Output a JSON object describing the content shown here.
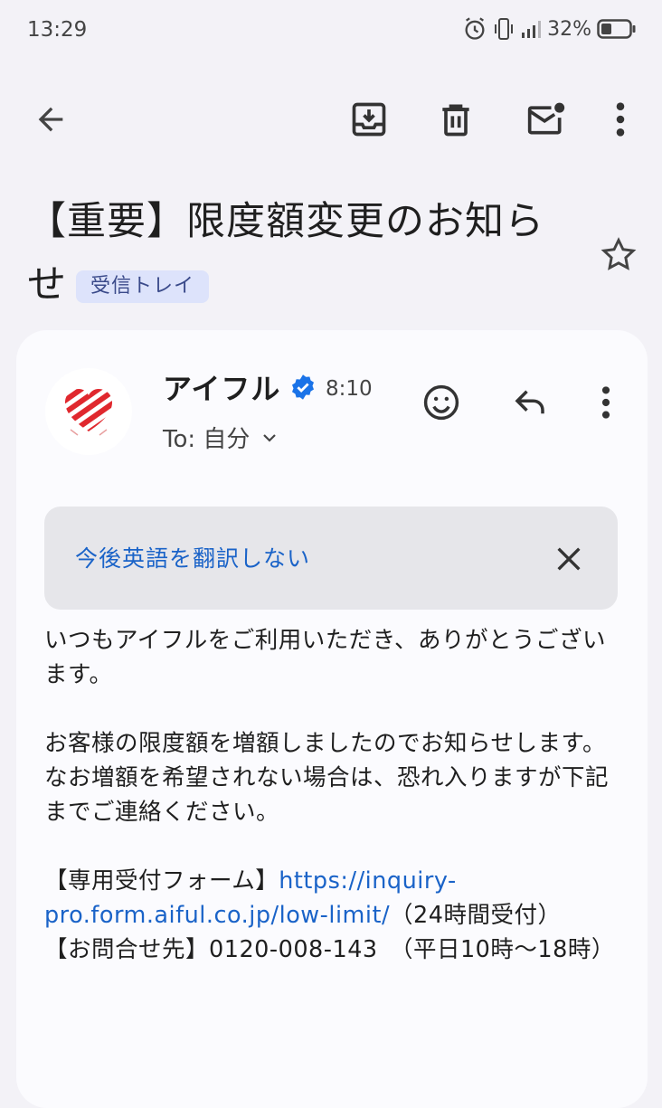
{
  "status_bar": {
    "time": "13:29",
    "battery": "32%",
    "icons": [
      "alarm-icon",
      "vibrate-icon",
      "signal-icon",
      "battery-icon"
    ]
  },
  "app_bar": {
    "icons": [
      "back-arrow-icon",
      "archive-icon",
      "delete-icon",
      "mark-unread-icon",
      "more-vert-icon"
    ]
  },
  "subject": {
    "text": "【重要】限度額変更のお知らせ",
    "label": "受信トレイ"
  },
  "sender": {
    "name": "アイフル",
    "time": "8:10",
    "recipient": "To: 自分",
    "avatar_color": "#e0282e"
  },
  "translate_bar": {
    "text": "今後英語を翻訳しない"
  },
  "body": {
    "para1": "いつもアイフルをご利用いただき、ありがとうございます。",
    "para2_line1": "お客様の限度額を増額しましたのでお知らせします。",
    "para2_line2": "なお増額を希望されない場合は、恐れ入りますが下記までご連絡ください。",
    "form_label": "【専用受付フォーム】",
    "form_link": "https://inquiry-pro.form.aiful.co.jp/low-limit/",
    "form_note": "（24時間受付）",
    "contact_label": "【お問合せ先】",
    "contact_number": "0120-008-143",
    "contact_hours": "（平日10時〜18時）"
  },
  "colors": {
    "accent_link": "#1a63c8",
    "verified": "#1a73e8",
    "chip_bg": "#dde3fb"
  }
}
